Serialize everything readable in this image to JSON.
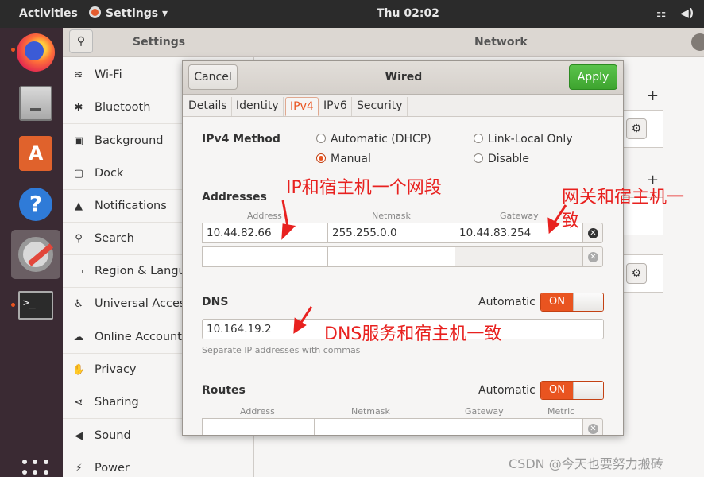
{
  "topbar": {
    "activities": "Activities",
    "app_menu": "Settings ▾",
    "clock": "Thu 02:02"
  },
  "sidebar": {
    "title": "Settings",
    "items": [
      {
        "label": "Wi-Fi",
        "icon": "wifi-icon",
        "glyph": "≋"
      },
      {
        "label": "Bluetooth",
        "icon": "bluetooth-icon",
        "glyph": "✱"
      },
      {
        "label": "Background",
        "icon": "background-icon",
        "glyph": "▣"
      },
      {
        "label": "Dock",
        "icon": "dock-icon",
        "glyph": "▢"
      },
      {
        "label": "Notifications",
        "icon": "bell-icon",
        "glyph": "▲"
      },
      {
        "label": "Search",
        "icon": "search-icon",
        "glyph": "⚲"
      },
      {
        "label": "Region & Language",
        "icon": "region-icon",
        "glyph": "▭"
      },
      {
        "label": "Universal Access",
        "icon": "accessibility-icon",
        "glyph": "♿"
      },
      {
        "label": "Online Accounts",
        "icon": "online-accounts-icon",
        "glyph": "☁"
      },
      {
        "label": "Privacy",
        "icon": "hand-icon",
        "glyph": "✋"
      },
      {
        "label": "Sharing",
        "icon": "share-icon",
        "glyph": "⋖"
      },
      {
        "label": "Sound",
        "icon": "speaker-icon",
        "glyph": "◀"
      },
      {
        "label": "Power",
        "icon": "power-icon",
        "glyph": "⚡"
      }
    ]
  },
  "main": {
    "title": "Network"
  },
  "dialog": {
    "title": "Wired",
    "cancel": "Cancel",
    "apply": "Apply",
    "tabs": [
      "Details",
      "Identity",
      "IPv4",
      "IPv6",
      "Security"
    ],
    "active_tab": "IPv4",
    "ipv4_method_label": "IPv4 Method",
    "methods": {
      "auto_dhcp": "Automatic (DHCP)",
      "link_local": "Link-Local Only",
      "manual": "Manual",
      "disable": "Disable"
    },
    "selected_method": "Manual",
    "addresses": {
      "label": "Addresses",
      "col_address": "Address",
      "col_netmask": "Netmask",
      "col_gateway": "Gateway",
      "row1": {
        "address": "10.44.82.66",
        "netmask": "255.255.0.0",
        "gateway": "10.44.83.254"
      }
    },
    "dns": {
      "label": "DNS",
      "automatic": "Automatic",
      "switch": "ON",
      "value": "10.164.19.2",
      "hint": "Separate IP addresses with commas"
    },
    "routes": {
      "label": "Routes",
      "automatic": "Automatic",
      "switch": "ON",
      "col_address": "Address",
      "col_netmask": "Netmask",
      "col_gateway": "Gateway",
      "col_metric": "Metric"
    }
  },
  "annotations": {
    "ip": "IP和宿主机一个网段",
    "gateway_line1": "网关和宿主机一",
    "gateway_line2": "致",
    "dns": "DNS服务和宿主机一致"
  },
  "watermark": "CSDN @今天也要努力搬砖",
  "colors": {
    "accent": "#e95420",
    "apply_green": "#4bb53b",
    "annotation_red": "#e8211f"
  }
}
